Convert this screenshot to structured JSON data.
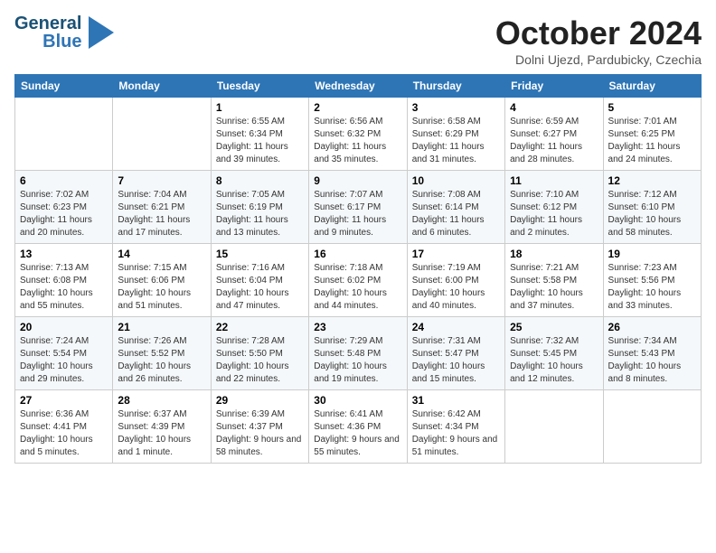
{
  "header": {
    "logo_line1": "General",
    "logo_line2": "Blue",
    "month": "October 2024",
    "location": "Dolni Ujezd, Pardubicky, Czechia"
  },
  "weekdays": [
    "Sunday",
    "Monday",
    "Tuesday",
    "Wednesday",
    "Thursday",
    "Friday",
    "Saturday"
  ],
  "weeks": [
    [
      {
        "day": "",
        "detail": ""
      },
      {
        "day": "",
        "detail": ""
      },
      {
        "day": "1",
        "detail": "Sunrise: 6:55 AM\nSunset: 6:34 PM\nDaylight: 11 hours\nand 39 minutes."
      },
      {
        "day": "2",
        "detail": "Sunrise: 6:56 AM\nSunset: 6:32 PM\nDaylight: 11 hours\nand 35 minutes."
      },
      {
        "day": "3",
        "detail": "Sunrise: 6:58 AM\nSunset: 6:29 PM\nDaylight: 11 hours\nand 31 minutes."
      },
      {
        "day": "4",
        "detail": "Sunrise: 6:59 AM\nSunset: 6:27 PM\nDaylight: 11 hours\nand 28 minutes."
      },
      {
        "day": "5",
        "detail": "Sunrise: 7:01 AM\nSunset: 6:25 PM\nDaylight: 11 hours\nand 24 minutes."
      }
    ],
    [
      {
        "day": "6",
        "detail": "Sunrise: 7:02 AM\nSunset: 6:23 PM\nDaylight: 11 hours\nand 20 minutes."
      },
      {
        "day": "7",
        "detail": "Sunrise: 7:04 AM\nSunset: 6:21 PM\nDaylight: 11 hours\nand 17 minutes."
      },
      {
        "day": "8",
        "detail": "Sunrise: 7:05 AM\nSunset: 6:19 PM\nDaylight: 11 hours\nand 13 minutes."
      },
      {
        "day": "9",
        "detail": "Sunrise: 7:07 AM\nSunset: 6:17 PM\nDaylight: 11 hours\nand 9 minutes."
      },
      {
        "day": "10",
        "detail": "Sunrise: 7:08 AM\nSunset: 6:14 PM\nDaylight: 11 hours\nand 6 minutes."
      },
      {
        "day": "11",
        "detail": "Sunrise: 7:10 AM\nSunset: 6:12 PM\nDaylight: 11 hours\nand 2 minutes."
      },
      {
        "day": "12",
        "detail": "Sunrise: 7:12 AM\nSunset: 6:10 PM\nDaylight: 10 hours\nand 58 minutes."
      }
    ],
    [
      {
        "day": "13",
        "detail": "Sunrise: 7:13 AM\nSunset: 6:08 PM\nDaylight: 10 hours\nand 55 minutes."
      },
      {
        "day": "14",
        "detail": "Sunrise: 7:15 AM\nSunset: 6:06 PM\nDaylight: 10 hours\nand 51 minutes."
      },
      {
        "day": "15",
        "detail": "Sunrise: 7:16 AM\nSunset: 6:04 PM\nDaylight: 10 hours\nand 47 minutes."
      },
      {
        "day": "16",
        "detail": "Sunrise: 7:18 AM\nSunset: 6:02 PM\nDaylight: 10 hours\nand 44 minutes."
      },
      {
        "day": "17",
        "detail": "Sunrise: 7:19 AM\nSunset: 6:00 PM\nDaylight: 10 hours\nand 40 minutes."
      },
      {
        "day": "18",
        "detail": "Sunrise: 7:21 AM\nSunset: 5:58 PM\nDaylight: 10 hours\nand 37 minutes."
      },
      {
        "day": "19",
        "detail": "Sunrise: 7:23 AM\nSunset: 5:56 PM\nDaylight: 10 hours\nand 33 minutes."
      }
    ],
    [
      {
        "day": "20",
        "detail": "Sunrise: 7:24 AM\nSunset: 5:54 PM\nDaylight: 10 hours\nand 29 minutes."
      },
      {
        "day": "21",
        "detail": "Sunrise: 7:26 AM\nSunset: 5:52 PM\nDaylight: 10 hours\nand 26 minutes."
      },
      {
        "day": "22",
        "detail": "Sunrise: 7:28 AM\nSunset: 5:50 PM\nDaylight: 10 hours\nand 22 minutes."
      },
      {
        "day": "23",
        "detail": "Sunrise: 7:29 AM\nSunset: 5:48 PM\nDaylight: 10 hours\nand 19 minutes."
      },
      {
        "day": "24",
        "detail": "Sunrise: 7:31 AM\nSunset: 5:47 PM\nDaylight: 10 hours\nand 15 minutes."
      },
      {
        "day": "25",
        "detail": "Sunrise: 7:32 AM\nSunset: 5:45 PM\nDaylight: 10 hours\nand 12 minutes."
      },
      {
        "day": "26",
        "detail": "Sunrise: 7:34 AM\nSunset: 5:43 PM\nDaylight: 10 hours\nand 8 minutes."
      }
    ],
    [
      {
        "day": "27",
        "detail": "Sunrise: 6:36 AM\nSunset: 4:41 PM\nDaylight: 10 hours\nand 5 minutes."
      },
      {
        "day": "28",
        "detail": "Sunrise: 6:37 AM\nSunset: 4:39 PM\nDaylight: 10 hours\nand 1 minute."
      },
      {
        "day": "29",
        "detail": "Sunrise: 6:39 AM\nSunset: 4:37 PM\nDaylight: 9 hours\nand 58 minutes."
      },
      {
        "day": "30",
        "detail": "Sunrise: 6:41 AM\nSunset: 4:36 PM\nDaylight: 9 hours\nand 55 minutes."
      },
      {
        "day": "31",
        "detail": "Sunrise: 6:42 AM\nSunset: 4:34 PM\nDaylight: 9 hours\nand 51 minutes."
      },
      {
        "day": "",
        "detail": ""
      },
      {
        "day": "",
        "detail": ""
      }
    ]
  ]
}
